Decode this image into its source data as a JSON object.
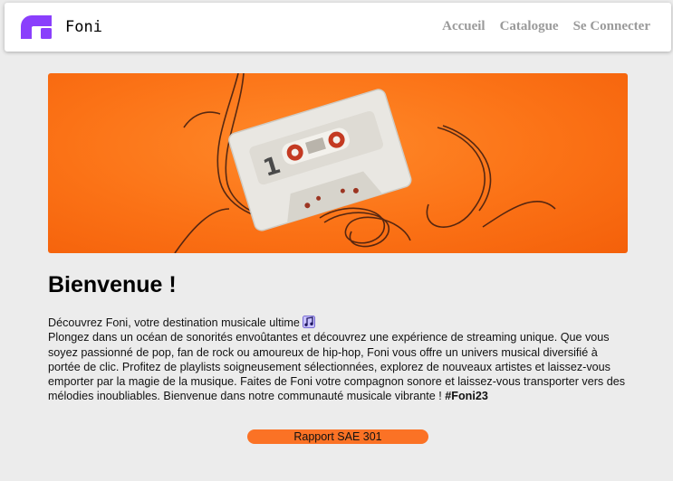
{
  "colors": {
    "brand_accent": "#8a3ffc",
    "hero_orange": "#fb7216",
    "button_orange": "#fb7225",
    "nav_link": "#9a9a9a",
    "background": "#ececec"
  },
  "header": {
    "logo_icon": "foni-logo-icon",
    "brand": "Foni",
    "nav": [
      {
        "label": "Accueil"
      },
      {
        "label": "Catalogue"
      },
      {
        "label": "Se Connecter"
      }
    ]
  },
  "hero": {
    "image": "cassette-tape-on-orange-background"
  },
  "main": {
    "title": "Bienvenue !",
    "intro_line": "Découvrez Foni, votre destination musicale ultime",
    "intro_icon": "music-notes-emoji",
    "body": "Plongez dans un océan de sonorités envoûtantes et découvrez une expérience de streaming unique. Que vous soyez passionné de pop, fan de rock ou amoureux de hip-hop, Foni vous offre un univers musical diversifié à portée de clic. Profitez de playlists soigneusement sélectionnées, explorez de nouveaux artistes et laissez-vous emporter par la magie de la musique. Faites de Foni votre compagnon sonore et laissez-vous transporter vers des mélodies inoubliables. Bienvenue dans notre communauté musicale vibrante !",
    "hashtag": "#Foni23"
  },
  "footer": {
    "report_button": "Rapport SAE 301"
  }
}
